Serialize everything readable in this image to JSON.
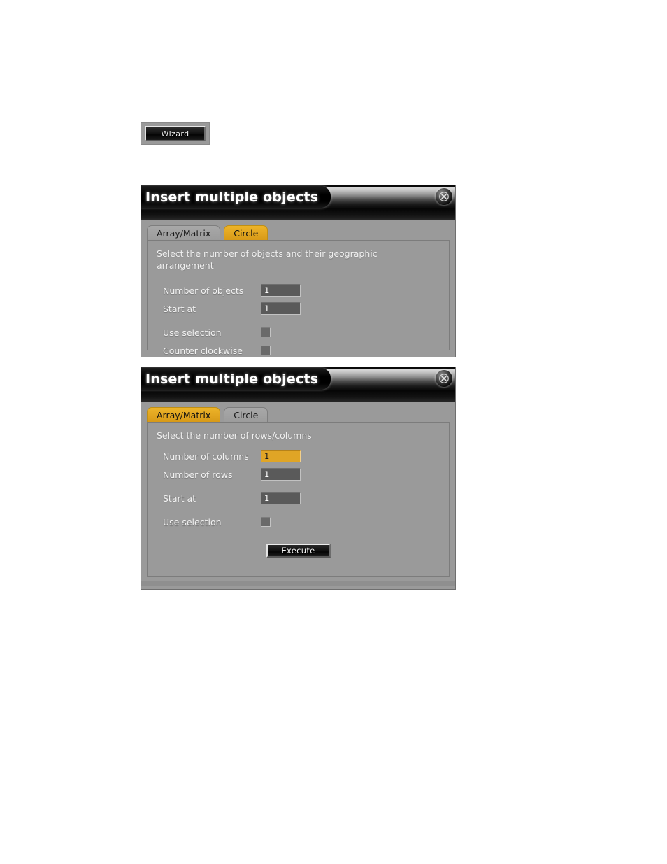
{
  "wizard": {
    "label": "Wizard"
  },
  "dialogs": [
    {
      "id": "circle",
      "title": "Insert multiple objects",
      "close_icon": "close-icon",
      "tabs": [
        {
          "label": "Array/Matrix",
          "active": false
        },
        {
          "label": "Circle",
          "active": true
        }
      ],
      "hint": "Select the number of objects and their geographic arrangement",
      "fields": [
        {
          "label": "Number of objects",
          "value": "1",
          "focused": false
        },
        {
          "label": "Start at",
          "value": "1",
          "focused": false
        }
      ],
      "checkboxes": [
        {
          "label": "Use selection",
          "checked": false
        },
        {
          "label": "Counter clockwise",
          "checked": false
        }
      ]
    },
    {
      "id": "array",
      "title": "Insert multiple objects",
      "close_icon": "close-icon",
      "tabs": [
        {
          "label": "Array/Matrix",
          "active": true
        },
        {
          "label": "Circle",
          "active": false
        }
      ],
      "hint": "Select the number of rows/columns",
      "fields": [
        {
          "label": "Number of columns",
          "value": "1",
          "focused": true
        },
        {
          "label": "Number of rows",
          "value": "1",
          "focused": false
        },
        {
          "label": "Start at",
          "value": "1",
          "focused": false
        }
      ],
      "checkboxes": [
        {
          "label": "Use selection",
          "checked": false
        }
      ],
      "execute_label": "Execute"
    }
  ],
  "colors": {
    "accent": "#e0a526",
    "panel": "#9a9a9a",
    "field": "#5a5a5a",
    "title_text": "#ffffff"
  }
}
